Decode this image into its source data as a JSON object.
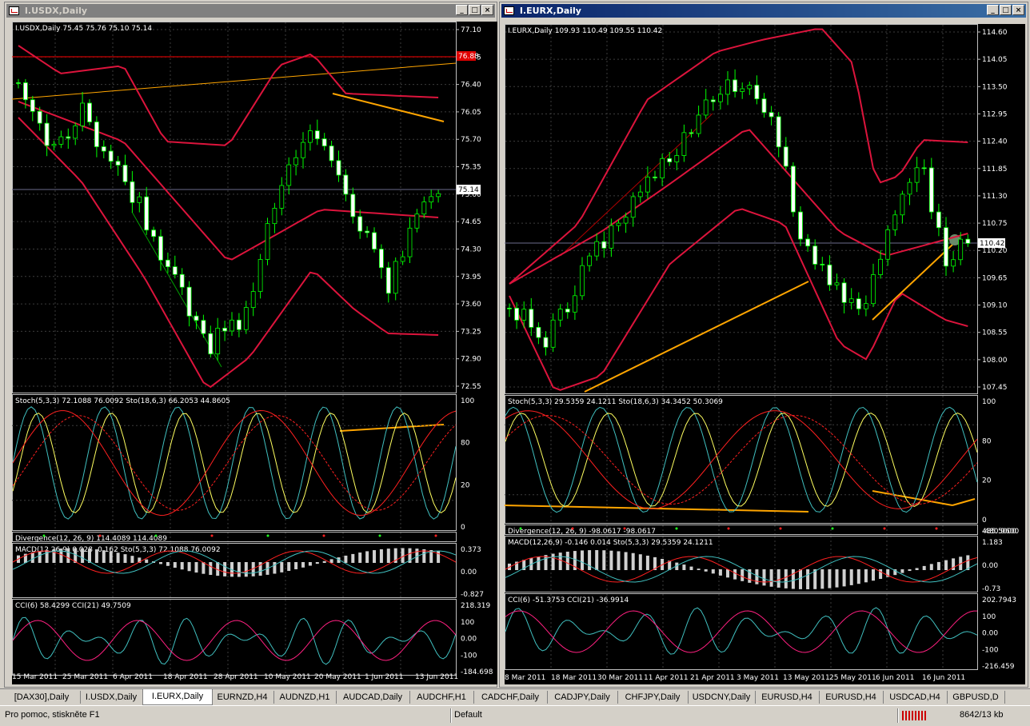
{
  "windows": [
    {
      "title": "I.USDX,Daily",
      "panes": {
        "price": {
          "header": "I.USDX,Daily  75.45 75.76 75.10 75.14",
          "scale": [
            "77.10",
            "76.75",
            "76.40",
            "76.05",
            "75.70",
            "75.35",
            "75.00",
            "74.65",
            "74.30",
            "73.95",
            "73.60",
            "73.25",
            "72.90",
            "72.55"
          ],
          "marker_red": "76.88",
          "marker_last": "75.14"
        },
        "stoch": {
          "header": "Stoch(5,3,3) 72.1088 76.0092  Sto(18,6,3) 66.2053 44.8605",
          "scale": [
            "100",
            "80",
            "20",
            "0"
          ]
        },
        "divergence": {
          "header": "Divergence(12, 26, 9) 114.4089 114.4089"
        },
        "macd": {
          "header": "MACD(12,26,9) 0.028 -0.162  Sto(5,3,3) 72.1088 76.0092",
          "scale": [
            "0.373",
            "0.00",
            "-0.827"
          ]
        },
        "cci": {
          "header": "CCI(6) 58.4299  CCI(21) 49.7509",
          "scale": [
            "218.319",
            "100",
            "0.00",
            "-100",
            "-184.698"
          ]
        }
      },
      "dates": [
        "15 Mar 2011",
        "25 Mar 2011",
        "6 Apr 2011",
        "18 Apr 2011",
        "28 Apr 2011",
        "10 May 2011",
        "20 May 2011",
        "1 Jun 2011",
        "13 Jun 2011"
      ]
    },
    {
      "title": "I.EURX,Daily",
      "panes": {
        "price": {
          "header": "I.EURX,Daily  109.93 110.49 109.55 110.42",
          "scale": [
            "114.60",
            "114.05",
            "113.50",
            "112.95",
            "112.40",
            "111.85",
            "111.30",
            "110.75",
            "110.20",
            "109.65",
            "109.10",
            "108.55",
            "108.00",
            "107.45"
          ],
          "marker_last": "110.42"
        },
        "stoch": {
          "header": "Stoch(5,3,3) 29.5359 24.1211  Sto(18,6,3) 34.3452 50.3069",
          "scale": [
            "100",
            "80",
            "20",
            "0"
          ]
        },
        "divergence": {
          "header": "Divergence(12, 26, 9) -98.0617 -98.0617",
          "scale": [
            "485.5000",
            "-480.9600"
          ]
        },
        "macd": {
          "header": "MACD(12,26,9) -0.146 0.014  Sto(5,3,3) 29.5359 24.1211",
          "scale": [
            "1.183",
            "0.00",
            "-0.73"
          ]
        },
        "cci": {
          "header": "CCI(6) -51.3753  CCI(21) -36.9914",
          "scale": [
            "202.7943",
            "100",
            "0.00",
            "-100",
            "-216.459"
          ]
        }
      },
      "dates": [
        "8 Mar 2011",
        "18 Mar 2011",
        "30 Mar 2011",
        "11 Apr 2011",
        "21 Apr 2011",
        "3 May 2011",
        "13 May 2011",
        "25 May 2011",
        "6 Jun 2011",
        "16 Jun 2011"
      ]
    }
  ],
  "tabs": [
    "[DAX30],Daily",
    "I.USDX,Daily",
    "I.EURX,Daily",
    "EURNZD,H4",
    "AUDNZD,H1",
    "AUDCAD,Daily",
    "AUDCHF,H1",
    "CADCHF,Daily",
    "CADJPY,Daily",
    "CHFJPY,Daily",
    "USDCNY,Daily",
    "EURUSD,H4",
    "EURUSD,H4",
    "USDCAD,H4",
    "GBPUSD,D"
  ],
  "active_tab": "I.EURX,Daily",
  "status": {
    "help": "Pro pomoc, stiskněte F1",
    "profile": "Default",
    "traffic": "8642/13 kb"
  },
  "colors": {
    "background": "#000000",
    "candle_up": "#ffffff",
    "candle_outline": "#00ff00",
    "bands": "#dc143c",
    "trendline": "#ffa500",
    "grid": "#3c3c3c"
  }
}
